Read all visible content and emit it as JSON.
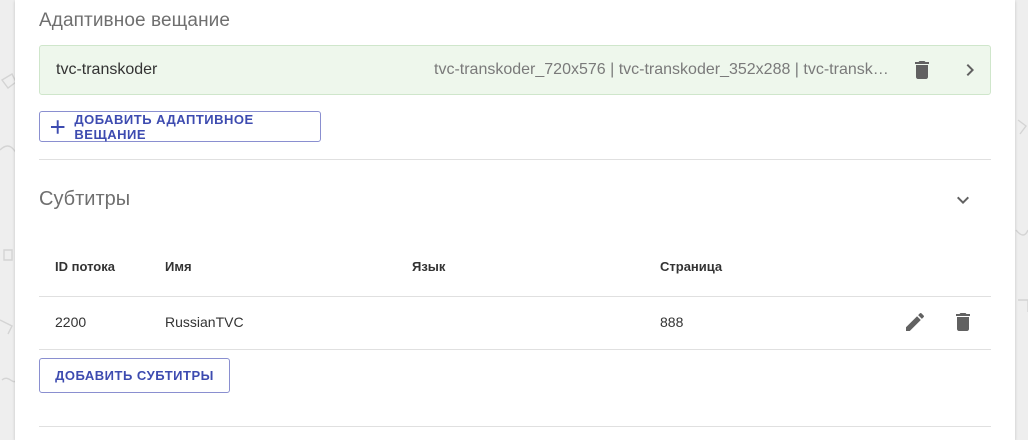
{
  "adaptive": {
    "title": "Адаптивное вещание",
    "items": [
      {
        "name": "tvc-transkoder",
        "variants": "tvc-transkoder_720x576 | tvc-transkoder_352x288 | tvc-transkoder_..."
      }
    ],
    "add_label": "ДОБАВИТЬ АДАПТИВНОЕ ВЕЩАНИЕ"
  },
  "subtitles": {
    "title": "Субтитры",
    "columns": [
      "ID потока",
      "Имя",
      "Язык",
      "Страница"
    ],
    "rows": [
      {
        "stream_id": "2200",
        "name": "RussianTVC",
        "language": "",
        "page": "888"
      }
    ],
    "add_label": "ДОБАВИТЬ СУБТИТРЫ"
  },
  "icons": {
    "delete": "trash-icon",
    "open": "chevron-right-icon",
    "expand": "chevron-down-icon",
    "edit": "pencil-icon",
    "add": "plus-icon"
  },
  "colors": {
    "accent": "#3d4bb0",
    "row_highlight": "#eef7ec",
    "icon": "#616161"
  }
}
